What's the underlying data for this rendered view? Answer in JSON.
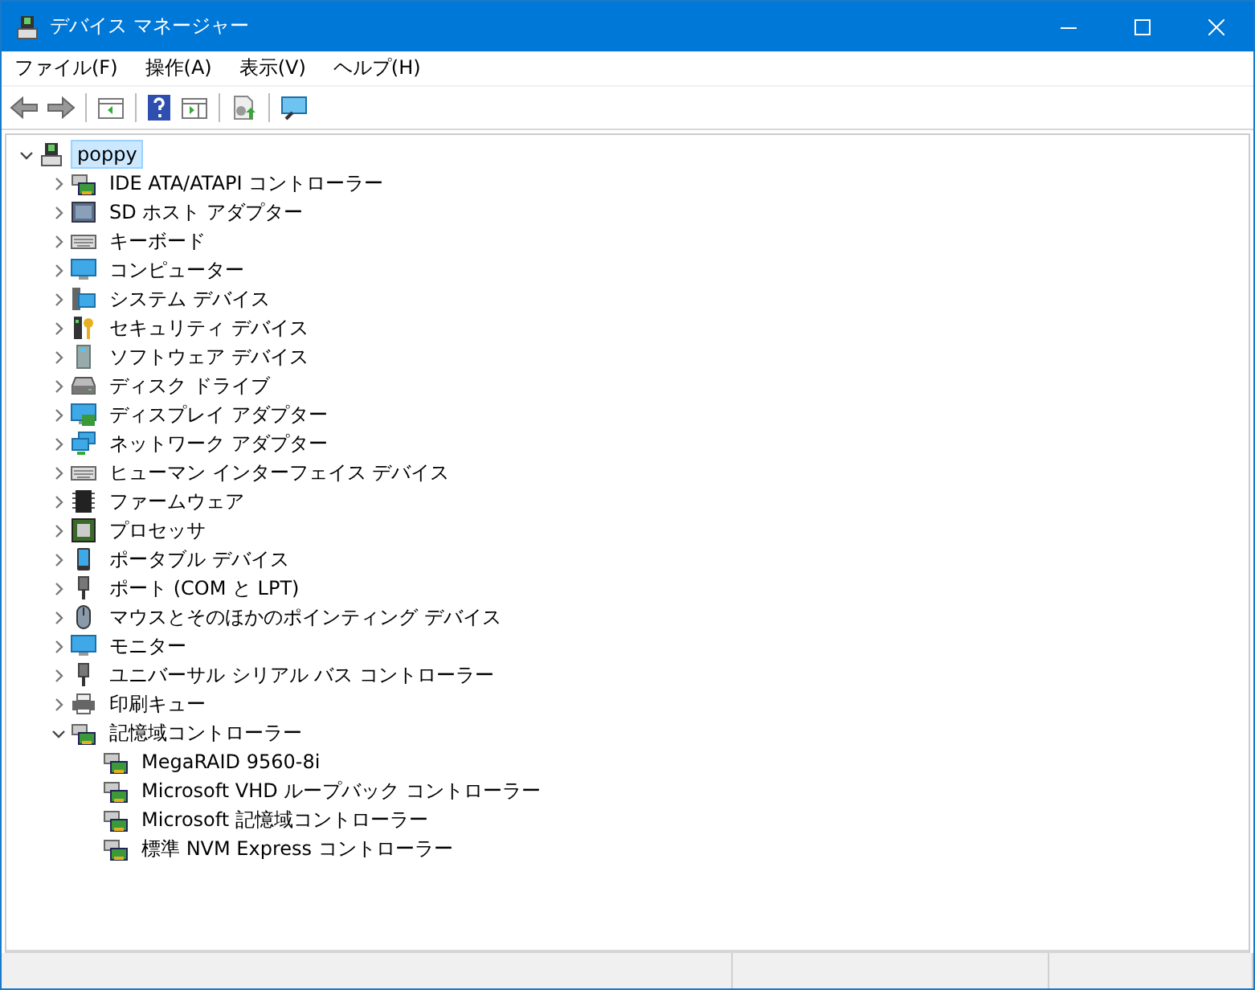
{
  "window": {
    "title": "デバイス マネージャー"
  },
  "menu": [
    "ファイル(F)",
    "操作(A)",
    "表示(V)",
    "ヘルプ(H)"
  ],
  "tree": {
    "label": "poppy",
    "expanded": true,
    "selected": true,
    "children": [
      {
        "label": "IDE ATA/ATAPI コントローラー",
        "expanded": false
      },
      {
        "label": "SD ホスト アダプター",
        "expanded": false
      },
      {
        "label": "キーボード",
        "expanded": false
      },
      {
        "label": "コンピューター",
        "expanded": false
      },
      {
        "label": "システム デバイス",
        "expanded": false
      },
      {
        "label": "セキュリティ デバイス",
        "expanded": false
      },
      {
        "label": "ソフトウェア デバイス",
        "expanded": false
      },
      {
        "label": "ディスク ドライブ",
        "expanded": false
      },
      {
        "label": "ディスプレイ アダプター",
        "expanded": false
      },
      {
        "label": "ネットワーク アダプター",
        "expanded": false
      },
      {
        "label": "ヒューマン インターフェイス デバイス",
        "expanded": false
      },
      {
        "label": "ファームウェア",
        "expanded": false
      },
      {
        "label": "プロセッサ",
        "expanded": false
      },
      {
        "label": "ポータブル デバイス",
        "expanded": false
      },
      {
        "label": "ポート (COM と LPT)",
        "expanded": false
      },
      {
        "label": "マウスとそのほかのポインティング デバイス",
        "expanded": false
      },
      {
        "label": "モニター",
        "expanded": false
      },
      {
        "label": "ユニバーサル シリアル バス コントローラー",
        "expanded": false
      },
      {
        "label": "印刷キュー",
        "expanded": false
      },
      {
        "label": "記憶域コントローラー",
        "expanded": true,
        "children": [
          {
            "label": "MegaRAID 9560-8i"
          },
          {
            "label": "Microsoft VHD ループバック コントローラー"
          },
          {
            "label": "Microsoft 記憶域コントローラー"
          },
          {
            "label": "標準 NVM Express コントローラー"
          }
        ]
      }
    ]
  }
}
